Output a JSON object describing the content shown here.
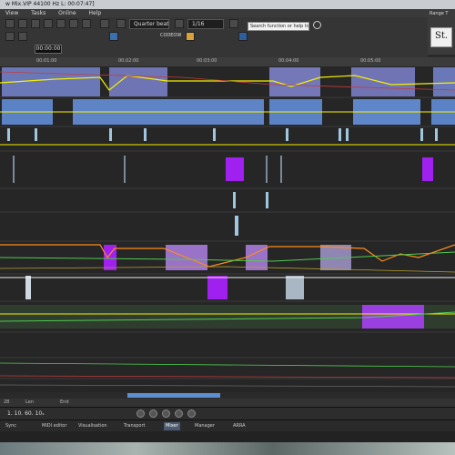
{
  "window": {
    "title": "w Mix.VIP  44100 Hz L: 00:07:47]"
  },
  "menu": {
    "items": [
      "View",
      "Tasks",
      "Online",
      "Help"
    ]
  },
  "toolbar": {
    "snap_value": "Quarter beat",
    "grid_value": "1/16",
    "timecode": "00:00:00",
    "preset_label": "CODEOW",
    "search_placeholder": "Search function or help topic"
  },
  "right_panel": {
    "label": "Range T",
    "box_text": "St."
  },
  "ruler": {
    "marks": [
      "00:01:00",
      "00:02:00",
      "00:03:00",
      "00:04:00",
      "00:05:00"
    ]
  },
  "info_bar": {
    "pos_value": "28",
    "len_label": "Len",
    "end_label": "End"
  },
  "transport": {
    "counter": "1.  10.  60.  10ₓ"
  },
  "tabs": {
    "items": [
      "Sync",
      "MIDI editor",
      "Visualisation",
      "Transport",
      "Mixer",
      "Manager",
      "ARRA"
    ]
  },
  "colors": {
    "clip_blue": "#5b82c4",
    "clip_purple": "#9a73c8",
    "clip_violet": "#a020f0",
    "line_yellow": "#f5f000",
    "line_orange": "#ff8c1a",
    "line_green": "#4fcc4f",
    "scroll_accent": "#5d8fd0"
  }
}
